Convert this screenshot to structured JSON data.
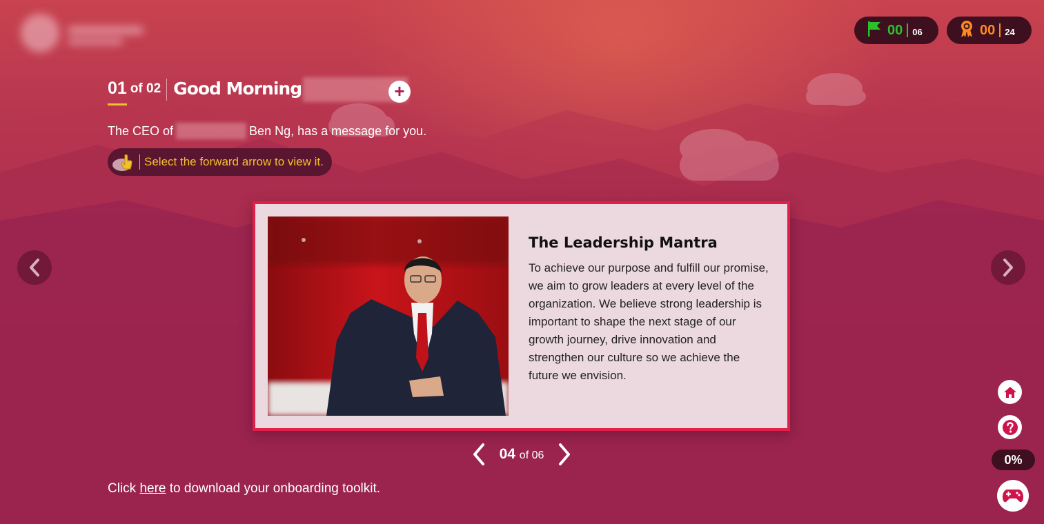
{
  "status": {
    "flags": {
      "current": "00",
      "total": "06",
      "color": "#2bc12b"
    },
    "badges": {
      "current": "00",
      "total": "24",
      "color": "#ff8a1f"
    }
  },
  "header": {
    "step_current": "01",
    "step_of": "of 02",
    "greeting": "Good Morning"
  },
  "intro": {
    "ceo_prefix": "The CEO of",
    "ceo_suffix": "Ben Ng, has a message for you.",
    "hint": "Select the forward arrow to view it."
  },
  "card": {
    "title": "The Leadership Mantra",
    "body": "To achieve our purpose and fulfill our promise, we aim to grow leaders at every level of the organization. We believe strong leadership is important to shape the next stage of our growth journey, drive innovation and strengthen our culture so we achieve the future we envision."
  },
  "pager": {
    "current": "04",
    "of": "of 06"
  },
  "footer": {
    "prefix": "Click",
    "link": "here",
    "suffix": "to download your onboarding toolkit."
  },
  "progress": "0%",
  "colors": {
    "accent": "#e0204a",
    "highlight": "#f2c12e",
    "dark_pill": "#3d0f1f"
  }
}
